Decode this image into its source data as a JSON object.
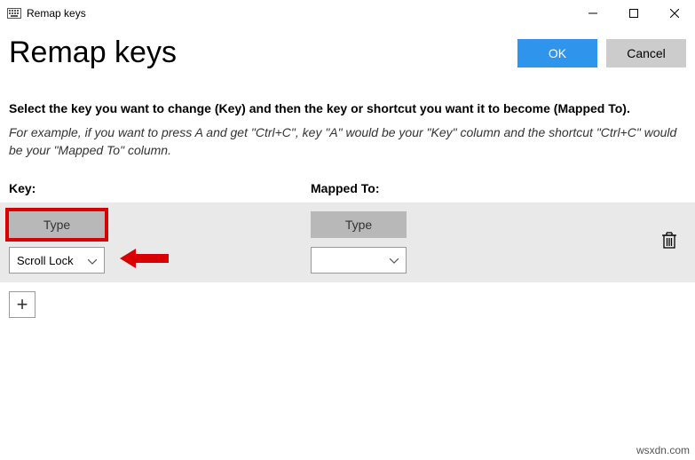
{
  "window": {
    "title": "Remap keys"
  },
  "header": {
    "page_title": "Remap keys",
    "ok_label": "OK",
    "cancel_label": "Cancel"
  },
  "body": {
    "instructions": "Select the key you want to change (Key) and then the key or shortcut you want it to become (Mapped To).",
    "example": "For example, if you want to press A and get \"Ctrl+C\", key \"A\" would be your \"Key\" column and the shortcut \"Ctrl+C\" would be your \"Mapped To\" column.",
    "col_key_label": "Key:",
    "col_mapped_label": "Mapped To:"
  },
  "row": {
    "key_type_label": "Type",
    "key_select_value": "Scroll Lock",
    "mapped_type_label": "Type",
    "mapped_select_value": ""
  },
  "icons": {
    "plus": "+"
  },
  "watermark": "wsxdn.com"
}
